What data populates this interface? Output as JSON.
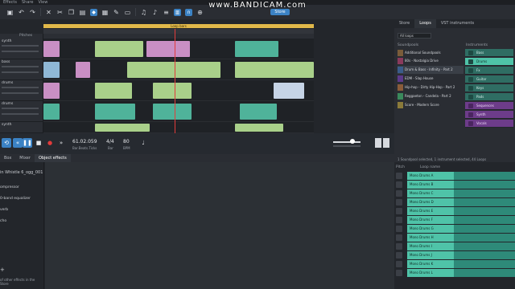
{
  "menu": [
    "Effects",
    "Share",
    "View"
  ],
  "watermark": {
    "title": "www.BANDICAM.com",
    "sub": "Store"
  },
  "tracks": {
    "header": "Pitches",
    "items": [
      {
        "name": "synth"
      },
      {
        "name": "bass"
      },
      {
        "name": "drums"
      },
      {
        "name": "drums"
      },
      {
        "name": "synth"
      }
    ]
  },
  "loop_label": "Loop bars",
  "transport": {
    "position": "61.02.059",
    "position_label": "Bar.Beats.Ticks",
    "signature": "4/4",
    "signature_label": "Bar",
    "bpm": "80",
    "bpm_label": "BPM"
  },
  "right_tabs": [
    "Store",
    "Loops",
    "VST instruments"
  ],
  "loops_filter": "All loops",
  "soundpools_header": "Soundpools",
  "instruments_header": "Instruments",
  "soundpools": [
    "Additional Soundpools",
    "80s - Nostalgia Drive",
    "Drum & Bass - Infinity - Part 2",
    "EDM - Slap House",
    "Hip-hop - Dirty Hip-Hop - Part 2",
    "Reggaeton - Candela - Part 2",
    "Score - Modern Score"
  ],
  "instruments": [
    "Bass",
    "Drums",
    "Fx",
    "Guitar",
    "Keys",
    "Pads",
    "Sequences",
    "Synth",
    "Vocals"
  ],
  "status": "1 Soundpool selected, 1 instrument selected, 44 Loops",
  "bottom_tabs": [
    "Box",
    "Mixer",
    "Object effects"
  ],
  "clip_name": "in Whistle 6_ogg_001",
  "effects": [
    "ompressor",
    "0-band equalizer",
    "verb",
    "cho"
  ],
  "more_effects": "of other effects in the Store",
  "loops_header": {
    "pitch": "Pitch",
    "name": "Loop name"
  },
  "loops": [
    "Mono Drums A",
    "Mono Drums B",
    "Mono Drums C",
    "Mono Drums D",
    "Mono Drums E",
    "Mono Drums F",
    "Mono Drums G",
    "Mono Drums H",
    "Mono Drums I",
    "Mono Drums J",
    "Mono Drums K",
    "Mono Drums L"
  ]
}
